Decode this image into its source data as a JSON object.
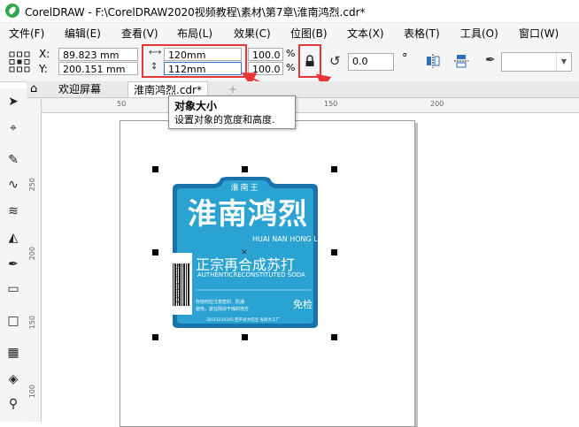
{
  "window": {
    "title": "CorelDRAW - F:\\CorelDRAW2020视频教程\\素材\\第7章\\淮南鸿烈.cdr*"
  },
  "menu": [
    "文件(F)",
    "编辑(E)",
    "查看(V)",
    "布局(L)",
    "效果(C)",
    "位图(B)",
    "文本(X)",
    "表格(T)",
    "工具(O)",
    "窗口(W)"
  ],
  "properties": {
    "x_label": "X:",
    "x_value": "89.823 mm",
    "y_label": "Y:",
    "y_value": "200.151 mm",
    "width_value": "120mm",
    "height_value": "112mm",
    "scale_w": "100.0",
    "scale_h": "100.0",
    "percent": "%",
    "rotation": "0.0",
    "degree": "°",
    "lock_state": "locked"
  },
  "tabs": {
    "welcome": "欢迎屏幕",
    "document": "淮南鸿烈.cdr*",
    "add": "+"
  },
  "tooltip": {
    "title": "对象大小",
    "description": "设置对象的宽度和高度."
  },
  "hruler": [
    "50",
    "100",
    "150",
    "200"
  ],
  "vruler": [
    "250",
    "200",
    "150",
    "100"
  ],
  "label_design": {
    "top_text": "淮南王",
    "main_title": "淮南鸿烈",
    "pinyin": "HUAI NAN HONG LIE",
    "slogan": "正宗再合成苏打",
    "slogan_en": "AUTHENTICRECONSTITUTED SODA",
    "small_text_1": "存放时应注意密封、防潮",
    "small_text_2": "避热，放在阴凉干燥的地方",
    "mark": "免检",
    "bottom_text": "ZJH23234345 西平县大旺宝 省商大工厂",
    "barcode_number": "6 921318 271279",
    "colors": {
      "label_blue": "#2aa3d2",
      "dark_blue": "#1773a9",
      "highlight": "#e8353a"
    }
  }
}
